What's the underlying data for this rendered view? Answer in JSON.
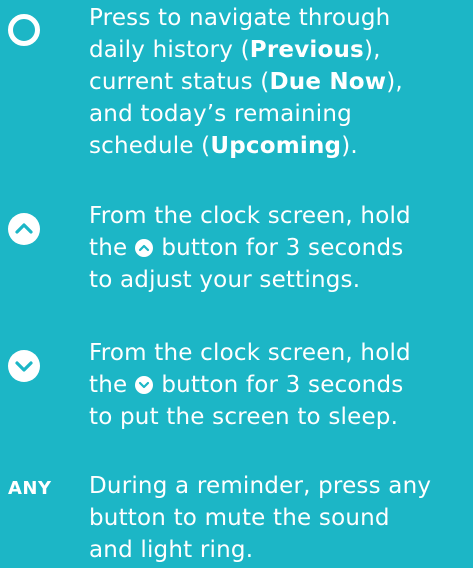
{
  "colors": {
    "background": "#1CB6C6",
    "foreground": "#ffffff"
  },
  "items": [
    {
      "icon": "circle-icon",
      "lines": {
        "l1": "Press to navigate through",
        "l2_pre": "daily history (",
        "l2_bold": "Previous",
        "l2_post": "),",
        "l3_pre": "current status (",
        "l3_bold": "Due Now",
        "l3_post": "),",
        "l4": "and today’s remaining",
        "l5_pre": "schedule (",
        "l5_bold": "Upcoming",
        "l5_post": ")."
      }
    },
    {
      "icon": "chevron-up-icon",
      "lines": {
        "l1": "From the clock screen, hold",
        "l2_pre": "the",
        "l2_post": "button for 3 seconds",
        "l3": "to adjust your settings."
      }
    },
    {
      "icon": "chevron-down-icon",
      "lines": {
        "l1": "From the clock screen, hold",
        "l2_pre": "the",
        "l2_post": "button for 3 seconds",
        "l3": "to put the screen to sleep."
      }
    },
    {
      "label": "ANY",
      "lines": {
        "l1": "During a reminder, press any",
        "l2": "button to mute the sound",
        "l3": "and light ring."
      }
    }
  ]
}
